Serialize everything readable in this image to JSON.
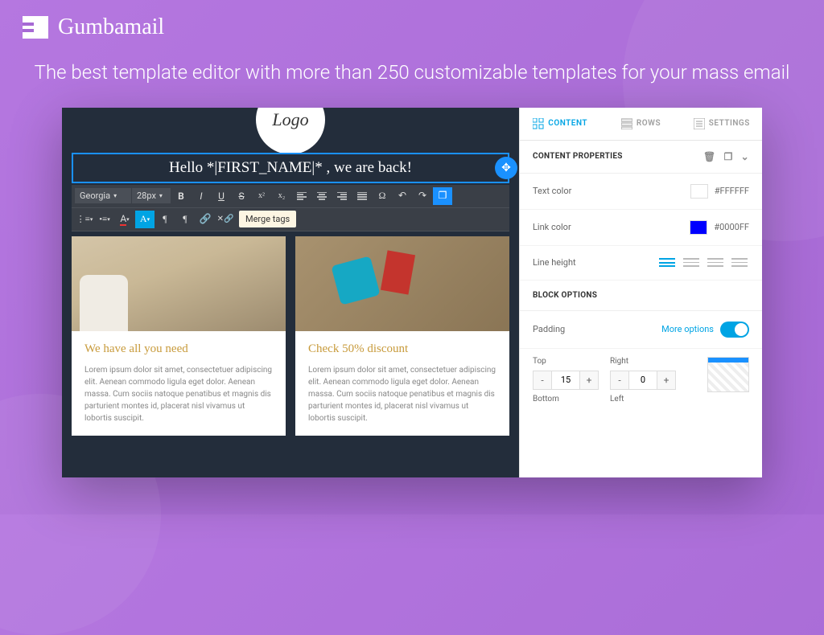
{
  "brand": "Gumbamail",
  "tagline": "The best template editor with more than 250 customizable templates for your mass email",
  "canvas": {
    "logo_text": "Logo",
    "headline": "Hello *|FIRST_NAME|* , we are back!",
    "toolbar": {
      "font": "Georgia",
      "size": "28px",
      "tooltip": "Merge tags"
    },
    "cards": [
      {
        "title": "We have all you need",
        "text": "Lorem ipsum dolor sit amet, consectetuer adipiscing elit. Aenean commodo ligula eget dolor. Aenean massa. Cum sociis natoque penatibus et magnis dis parturient montes id, placerat nisl vivamus ut lobortis suscipit."
      },
      {
        "title": "Check 50% discount",
        "text": "Lorem ipsum dolor sit amet, consectetuer adipiscing elit. Aenean commodo ligula eget dolor. Aenean massa. Cum sociis natoque penatibus et magnis dis parturient montes id, placerat nisl vivamus ut lobortis suscipit."
      }
    ]
  },
  "panel": {
    "tabs": [
      {
        "label": "CONTENT",
        "active": true
      },
      {
        "label": "ROWS",
        "active": false
      },
      {
        "label": "SETTINGS",
        "active": false
      }
    ],
    "section1_title": "CONTENT PROPERTIES",
    "text_color_label": "Text color",
    "text_color_value": "#FFFFFF",
    "link_color_label": "Link color",
    "link_color_value": "#0000FF",
    "line_height_label": "Line height",
    "section2_title": "BLOCK OPTIONS",
    "padding_label": "Padding",
    "more_options": "More options",
    "pad": {
      "top_label": "Top",
      "top_value": "15",
      "right_label": "Right",
      "right_value": "0",
      "bottom_label": "Bottom",
      "left_label": "Left"
    }
  }
}
